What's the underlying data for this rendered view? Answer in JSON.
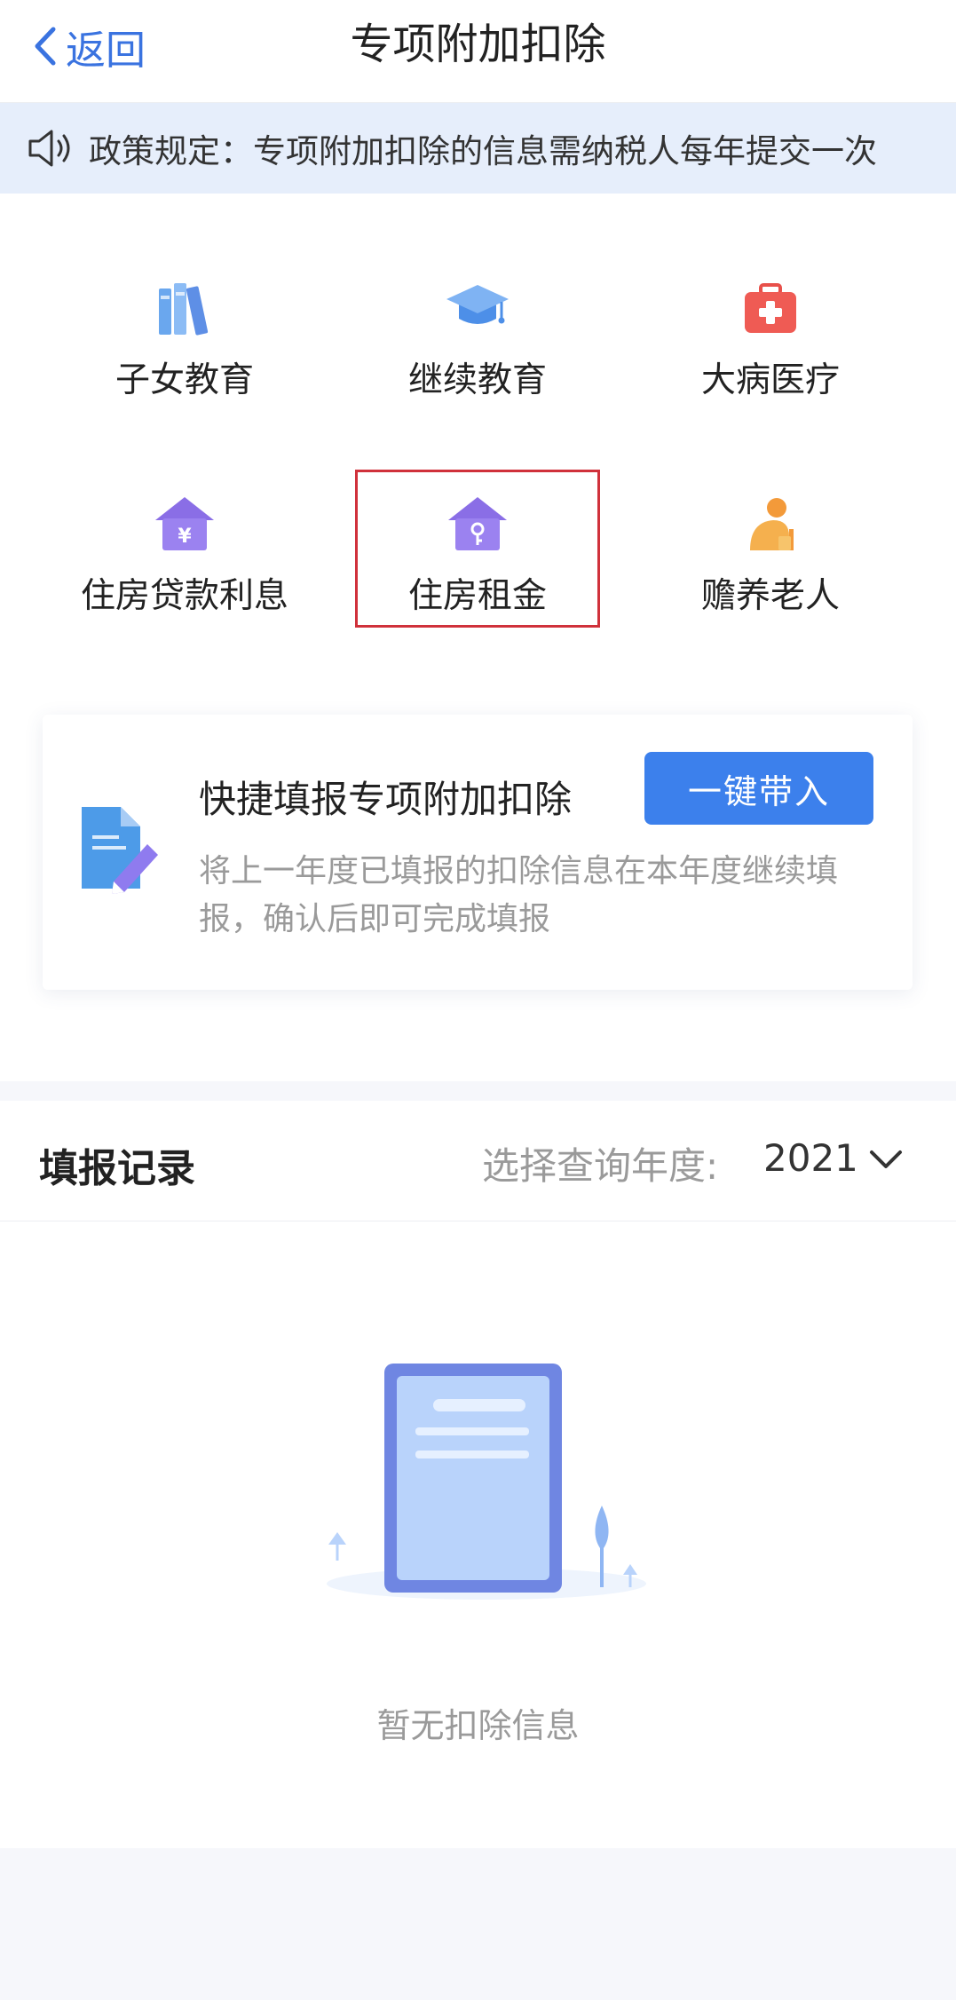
{
  "header": {
    "back_label": "返回",
    "title": "专项附加扣除"
  },
  "notice": {
    "text": "政策规定：专项附加扣除的信息需纳税人每年提交一次"
  },
  "categories": [
    {
      "label": "子女教育",
      "icon": "books-icon"
    },
    {
      "label": "继续教育",
      "icon": "graduation-cap-icon"
    },
    {
      "label": "大病医疗",
      "icon": "medical-kit-icon"
    },
    {
      "label": "住房贷款利息",
      "icon": "house-yuan-icon"
    },
    {
      "label": "住房租金",
      "icon": "house-key-icon"
    },
    {
      "label": "赡养老人",
      "icon": "elderly-person-icon"
    }
  ],
  "quick_fill": {
    "title": "快捷填报专项附加扣除",
    "button_label": "一键带入",
    "description": "将上一年度已填报的扣除信息在本年度继续填报，确认后即可完成填报"
  },
  "records": {
    "title": "填报记录",
    "year_label": "选择查询年度:",
    "year_value": "2021",
    "empty_text": "暂无扣除信息"
  },
  "colors": {
    "accent": "#3c80ec",
    "highlight_border": "#d0313b",
    "notice_bg": "#e6eefb"
  }
}
